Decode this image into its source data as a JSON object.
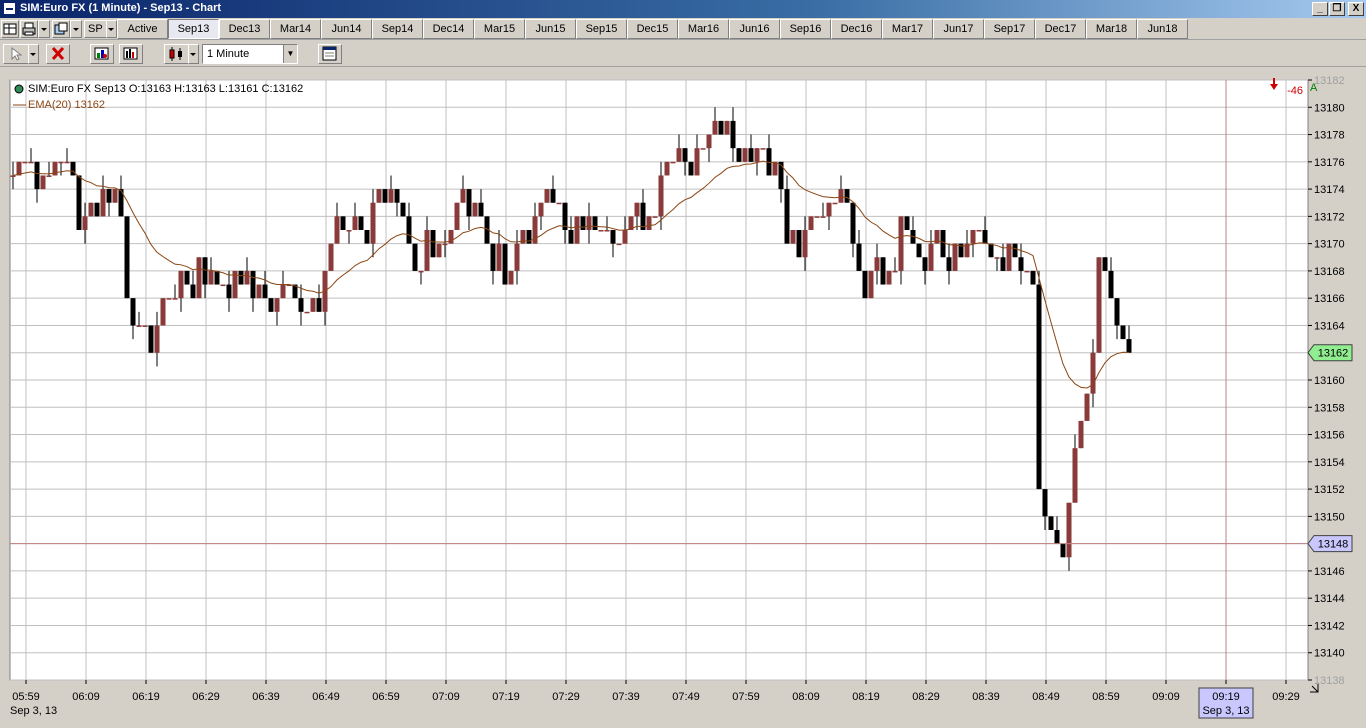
{
  "window": {
    "title": "SIM:Euro FX (1 Minute) - Sep13 - Chart",
    "minimize_glyph": "_",
    "restore_glyph": "❐",
    "close_glyph": "X"
  },
  "instrument_selector": {
    "label": "SP"
  },
  "tabs": [
    {
      "label": "Active",
      "selected": false
    },
    {
      "label": "Sep13",
      "selected": true
    },
    {
      "label": "Dec13",
      "selected": false
    },
    {
      "label": "Mar14",
      "selected": false
    },
    {
      "label": "Jun14",
      "selected": false
    },
    {
      "label": "Sep14",
      "selected": false
    },
    {
      "label": "Dec14",
      "selected": false
    },
    {
      "label": "Mar15",
      "selected": false
    },
    {
      "label": "Jun15",
      "selected": false
    },
    {
      "label": "Sep15",
      "selected": false
    },
    {
      "label": "Dec15",
      "selected": false
    },
    {
      "label": "Mar16",
      "selected": false
    },
    {
      "label": "Jun16",
      "selected": false
    },
    {
      "label": "Sep16",
      "selected": false
    },
    {
      "label": "Dec16",
      "selected": false
    },
    {
      "label": "Mar17",
      "selected": false
    },
    {
      "label": "Jun17",
      "selected": false
    },
    {
      "label": "Sep17",
      "selected": false
    },
    {
      "label": "Dec17",
      "selected": false
    },
    {
      "label": "Mar18",
      "selected": false
    },
    {
      "label": "Jun18",
      "selected": false
    }
  ],
  "toolbar": {
    "interval": "1 Minute",
    "icons": [
      "pointer-icon",
      "remove-icon",
      "data-box-icon",
      "indicators-icon",
      "candlestick-style-icon",
      "properties-icon"
    ]
  },
  "chart_data": {
    "type": "candlestick",
    "header_line": "SIM:Euro FX Sep13 O:13163 H:13163 L:13161 C:13162",
    "indicator_line": "EMA(20)  13162",
    "pnl_badge": "-46",
    "auto_scale_label": "A",
    "ylim": [
      13138,
      13182
    ],
    "y_ticks": [
      13138,
      13140,
      13142,
      13144,
      13146,
      13148,
      13150,
      13152,
      13154,
      13156,
      13158,
      13160,
      13162,
      13164,
      13166,
      13168,
      13170,
      13172,
      13174,
      13176,
      13178,
      13180,
      13182
    ],
    "x_ticks": [
      "05:59",
      "06:09",
      "06:19",
      "06:29",
      "06:39",
      "06:49",
      "06:59",
      "07:09",
      "07:19",
      "07:29",
      "07:39",
      "07:49",
      "07:59",
      "08:09",
      "08:19",
      "08:29",
      "08:39",
      "08:49",
      "08:59",
      "09:09",
      "09:19",
      "09:29"
    ],
    "date_label": "Sep 3, 13",
    "cursor": {
      "time": "09:19",
      "date": "Sep 3, 13",
      "price": 13148
    },
    "last_price": 13162,
    "colors": {
      "up": "#8b3a3a",
      "down": "#000000",
      "ema": "#8b4513",
      "grid": "#c0c0c0",
      "crosshair": "#c08080",
      "last_price_bg": "#90ee90",
      "cursor_bg": "#c8c8ff"
    },
    "first_bar_time": "05:58",
    "closes": [
      13175,
      13176,
      13176,
      13176,
      13174,
      13175,
      13175,
      13176,
      13176,
      13176,
      13175,
      13171,
      13172,
      13173,
      13172,
      13174,
      13173,
      13174,
      13172,
      13166,
      13164,
      13164,
      13164,
      13162,
      13164,
      13166,
      13166,
      13166,
      13168,
      13167,
      13166,
      13169,
      13167,
      13168,
      13167,
      13167,
      13166,
      13168,
      13167,
      13168,
      13166,
      13167,
      13166,
      13165,
      13166,
      13167,
      13167,
      13166,
      13165,
      13165,
      13166,
      13165,
      13168,
      13170,
      13172,
      13171,
      13171,
      13172,
      13171,
      13170,
      13173,
      13174,
      13173,
      13174,
      13173,
      13172,
      13170,
      13168,
      13168,
      13171,
      13169,
      13170,
      13170,
      13171,
      13173,
      13174,
      13172,
      13173,
      13172,
      13170,
      13168,
      13170,
      13167,
      13168,
      13170,
      13171,
      13170,
      13172,
      13173,
      13174,
      13173,
      13173,
      13171,
      13170,
      13172,
      13171,
      13172,
      13171,
      13171,
      13171,
      13170,
      13170,
      13171,
      13172,
      13173,
      13171,
      13172,
      13172,
      13175,
      13176,
      13176,
      13177,
      13176,
      13175,
      13177,
      13177,
      13178,
      13179,
      13178,
      13179,
      13177,
      13176,
      13177,
      13176,
      13177,
      13177,
      13175,
      13176,
      13174,
      13170,
      13171,
      13169,
      13171,
      13172,
      13172,
      13172,
      13173,
      13173,
      13174,
      13173,
      13170,
      13168,
      13166,
      13168,
      13169,
      13167,
      13168,
      13168,
      13172,
      13171,
      13170,
      13169,
      13168,
      13170,
      13171,
      13169,
      13168,
      13170,
      13169,
      13170,
      13171,
      13171,
      13170,
      13169,
      13169,
      13168,
      13170,
      13169,
      13168,
      13168,
      13167,
      13152,
      13150,
      13149,
      13148,
      13147,
      13151,
      13155,
      13157,
      13159,
      13162,
      13169,
      13168,
      13166,
      13164,
      13163,
      13162
    ],
    "ema_label": "EMA(20)"
  }
}
